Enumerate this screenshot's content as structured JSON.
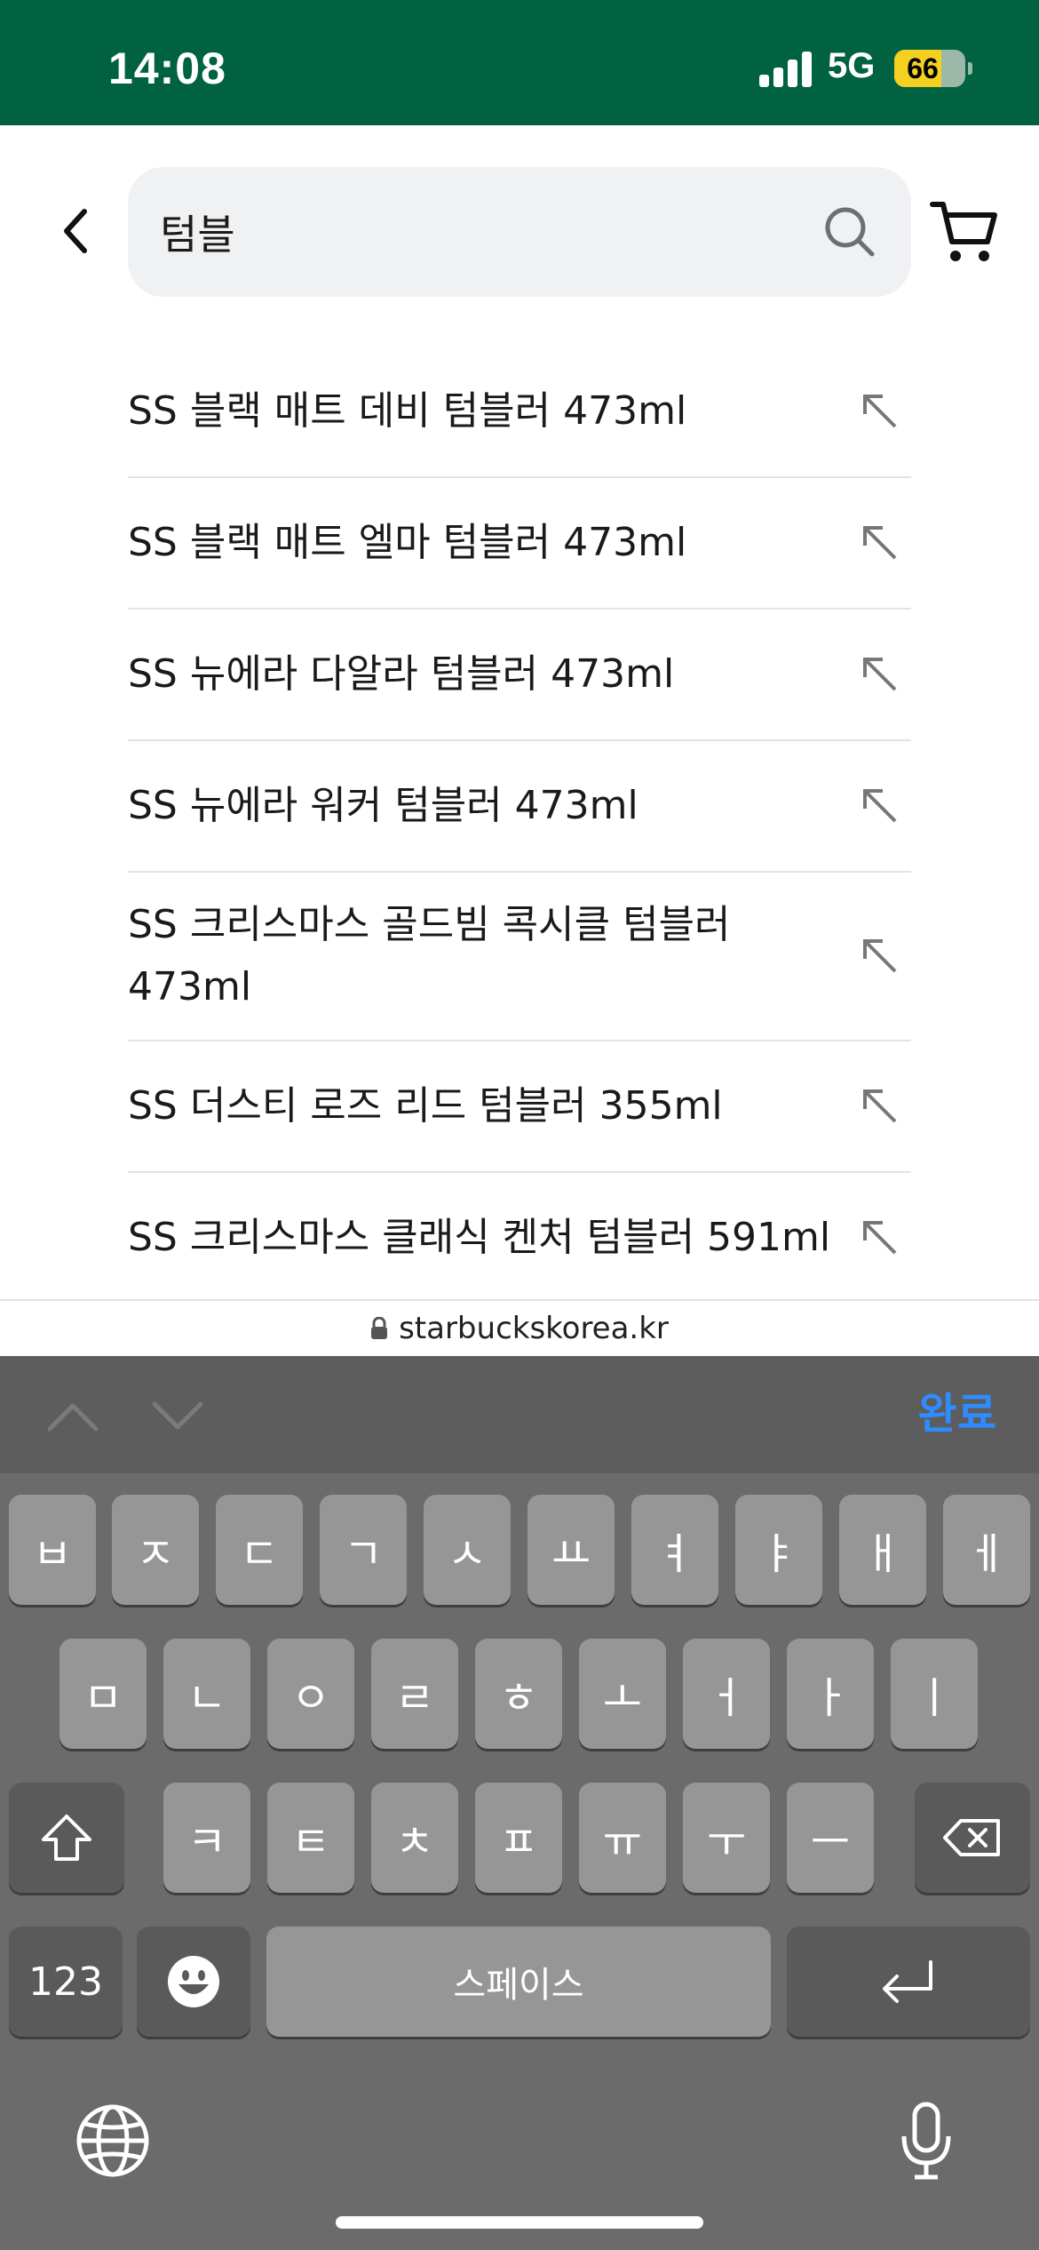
{
  "status": {
    "time": "14:08",
    "network": "5G",
    "battery": "66",
    "battery_level": 0.66
  },
  "search": {
    "value": "텀블",
    "placeholder": ""
  },
  "suggestions": [
    {
      "label": "SS 블랙 매트 데비 텀블러 473ml"
    },
    {
      "label": "SS 블랙 매트 엘마 텀블러 473ml"
    },
    {
      "label": "SS 뉴에라 다알라 텀블러 473ml"
    },
    {
      "label": "SS 뉴에라 워커 텀블러 473ml"
    },
    {
      "label": "SS 크리스마스 골드빔 콕시클 텀블러 473ml"
    },
    {
      "label": "SS 더스티 로즈 리드 텀블러 355ml"
    },
    {
      "label": "SS 크리스마스 클래식 켄처 텀블러 591ml"
    }
  ],
  "url_bar": {
    "domain": "starbuckskorea.kr"
  },
  "keyboard": {
    "done_label": "완료",
    "row1": [
      "ㅂ",
      "ㅈ",
      "ㄷ",
      "ㄱ",
      "ㅅ",
      "ㅛ",
      "ㅕ",
      "ㅑ",
      "ㅐ",
      "ㅔ"
    ],
    "row2": [
      "ㅁ",
      "ㄴ",
      "ㅇ",
      "ㄹ",
      "ㅎ",
      "ㅗ",
      "ㅓ",
      "ㅏ",
      "ㅣ"
    ],
    "row3": [
      "ㅋ",
      "ㅌ",
      "ㅊ",
      "ㅍ",
      "ㅠ",
      "ㅜ",
      "ㅡ"
    ],
    "numbers_label": "123",
    "space_label": "스페이스"
  },
  "colors": {
    "brand_green": "#006241",
    "keyboard_bg": "#6b6b6b",
    "key_bg": "#969696",
    "done_blue": "#2f8cff"
  }
}
